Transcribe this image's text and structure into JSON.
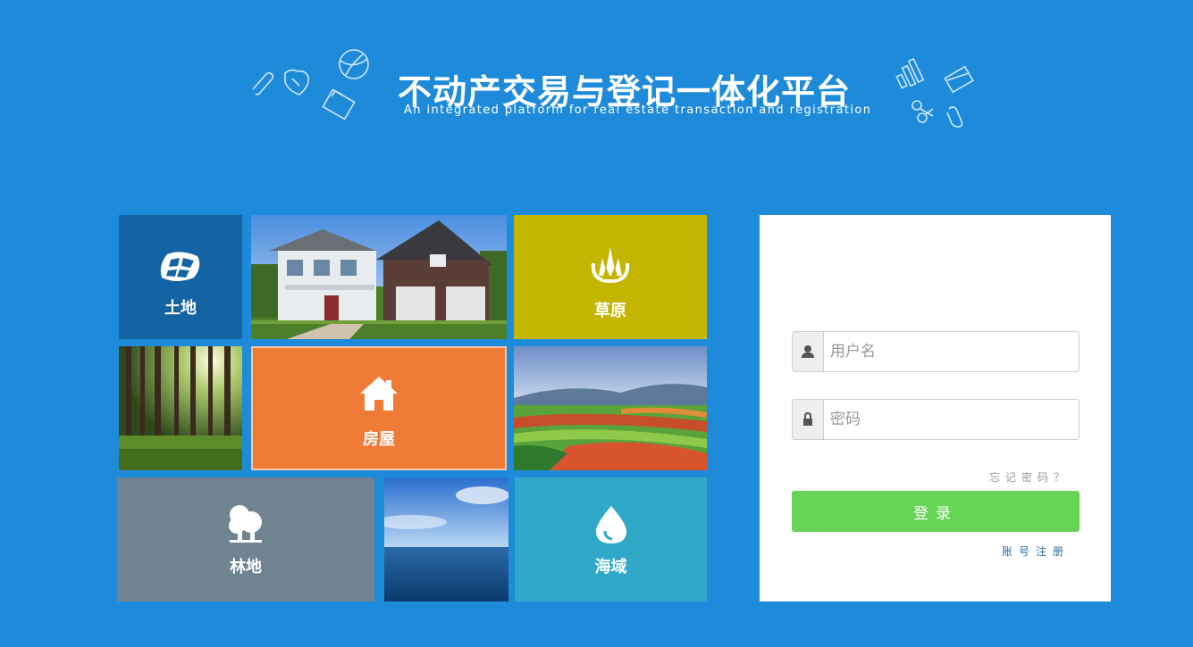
{
  "header": {
    "title": "不动产交易与登记一体化平台",
    "subtitle": "An integrated platform for real estate transaction and registration"
  },
  "tiles": {
    "land": {
      "label": "土地",
      "icon": "land-icon",
      "color": "#1464a3"
    },
    "grassland": {
      "label": "草原",
      "icon": "grassland-icon",
      "color": "#c3b500"
    },
    "house": {
      "label": "房屋",
      "icon": "house-icon",
      "color": "#f07b37"
    },
    "forest": {
      "label": "林地",
      "icon": "tree-icon",
      "color": "#6f8490"
    },
    "sea": {
      "label": "海域",
      "icon": "water-drop-icon",
      "color": "#30a9c9"
    }
  },
  "login": {
    "username_placeholder": "用户名",
    "password_placeholder": "密码",
    "forgot_label": "忘记密码？",
    "login_label": "登录",
    "register_label": "账号注册",
    "accent": "#66d454"
  }
}
